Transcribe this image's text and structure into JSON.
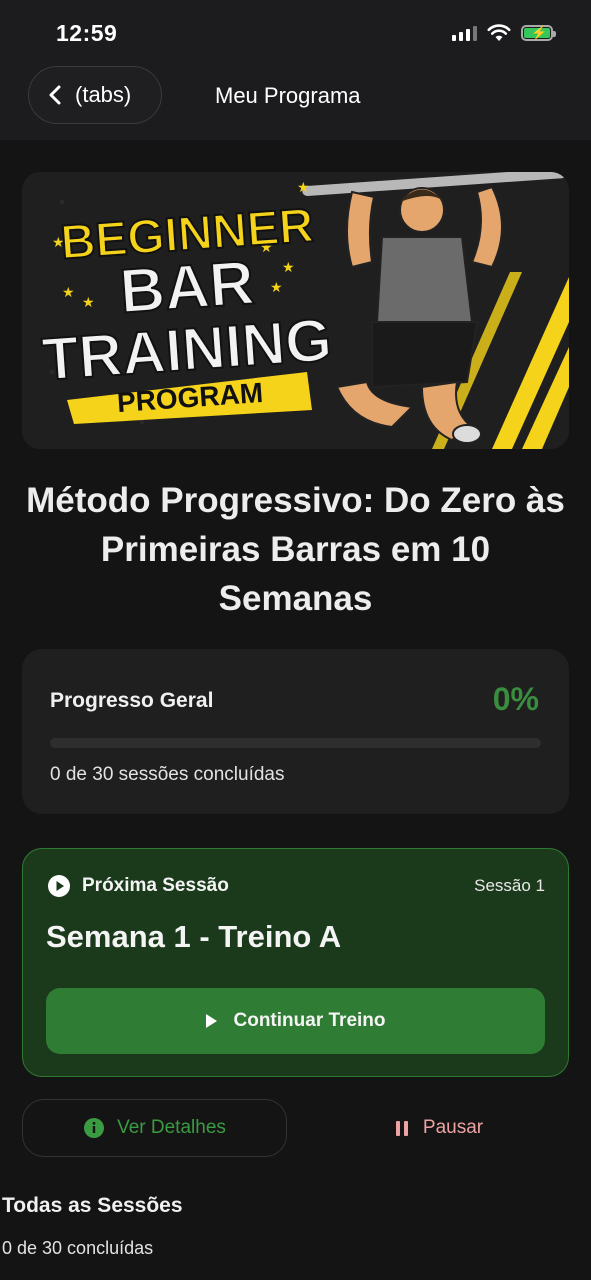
{
  "status_bar": {
    "time": "12:59",
    "icons": [
      "cellular-signal-icon",
      "wifi-icon",
      "battery-charging-icon"
    ]
  },
  "nav": {
    "back_label": "(tabs)",
    "title": "Meu Programa"
  },
  "banner": {
    "image_text": [
      "BEGINNER",
      "BAR",
      "TRAINING",
      "PROGRAM"
    ],
    "accent_color": "#f5d31a"
  },
  "program": {
    "title": "Método Progressivo: Do Zero às Primeiras Barras em 10 Semanas"
  },
  "progress": {
    "label": "Progresso Geral",
    "percent_text": "0%",
    "percent_value": 0,
    "sessions_text": "0 de 30 sessões concluídas"
  },
  "next_session": {
    "label": "Próxima Sessão",
    "session_number": "Sessão 1",
    "title": "Semana 1 - Treino A",
    "button_label": "Continuar Treino"
  },
  "actions": {
    "details_label": "Ver Detalhes",
    "pause_label": "Pausar"
  },
  "all_sessions": {
    "title": "Todas as Sessões",
    "count_text": "0 de 30 concluídas"
  },
  "colors": {
    "background": "#141414",
    "accent_green": "#3a8c3f",
    "card_green": "#1b3a1c",
    "pause_red": "#eda3a3"
  }
}
